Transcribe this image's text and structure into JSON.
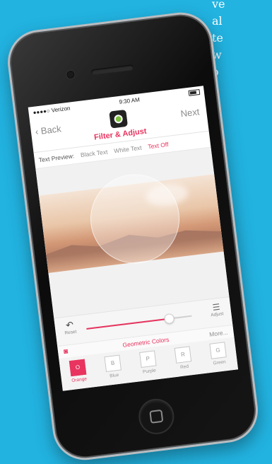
{
  "side_text": [
    "ve",
    "al",
    "te",
    "w",
    "o"
  ],
  "status": {
    "carrier": "●●●●○ Verizon",
    "time": "9:30 AM"
  },
  "nav": {
    "back_label": "Back",
    "title": "Filter & Adjust",
    "next_label": "Next"
  },
  "text_preview": {
    "label": "Text Preview:",
    "options": [
      "Black Text",
      "White Text",
      "Text Off"
    ],
    "selected": "Text Off"
  },
  "controls": {
    "reset_label": "Reset",
    "adjust_label": "Adjust",
    "slider_value": 0.78
  },
  "filters": {
    "title": "Geometric Colors",
    "more_label": "More...",
    "items": [
      {
        "letter": "O",
        "label": "Orange",
        "active": true
      },
      {
        "letter": "B",
        "label": "Blue",
        "active": false
      },
      {
        "letter": "P",
        "label": "Purple",
        "active": false
      },
      {
        "letter": "R",
        "label": "Red",
        "active": false
      },
      {
        "letter": "G",
        "label": "Green",
        "active": false
      }
    ]
  },
  "colors": {
    "background": "#22b3e1",
    "accent": "#e8345f",
    "app_logo_green": "#7fc241"
  },
  "icons": {
    "back": "chevron-left-icon",
    "reset": "undo-arrow-icon",
    "adjust": "sliders-icon",
    "camera": "camera-icon",
    "home": "home-button-icon"
  }
}
